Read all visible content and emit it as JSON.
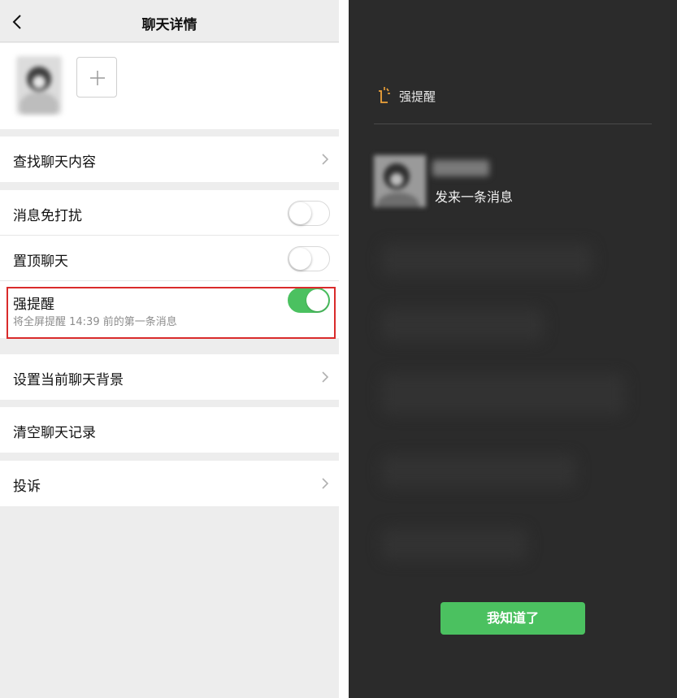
{
  "left": {
    "nav": {
      "title": "聊天详情"
    },
    "search_row": {
      "label": "查找聊天内容"
    },
    "mute_row": {
      "label": "消息免打扰",
      "on": false
    },
    "pin_row": {
      "label": "置顶聊天",
      "on": false
    },
    "strong_row": {
      "label": "强提醒",
      "subtitle": "将全屏提醒 14:39 前的第一条消息",
      "on": true
    },
    "background_row": {
      "label": "设置当前聊天背景"
    },
    "clear_row": {
      "label": "清空聊天记录"
    },
    "report_row": {
      "label": "投诉"
    }
  },
  "right": {
    "header": {
      "title": "强提醒"
    },
    "message": {
      "text": "发来一条消息"
    },
    "confirm_button": {
      "label": "我知道了"
    }
  },
  "colors": {
    "accent_green": "#4bc160",
    "highlight_red": "#d92b2b",
    "overlay_bg": "#2b2b2b",
    "strong_icon": "#f0a33a"
  },
  "icons": [
    "back-icon",
    "plus-icon",
    "chevron-right-icon",
    "strong-reminder-icon"
  ]
}
